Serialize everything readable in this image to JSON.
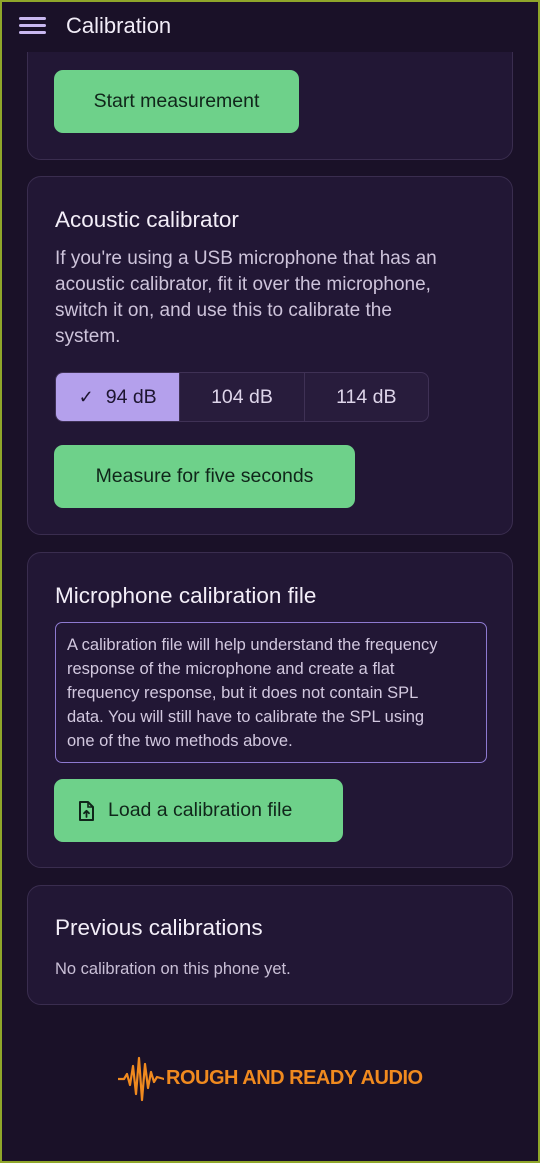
{
  "appbar": {
    "title": "Calibration"
  },
  "start_card": {
    "button_label": "Start measurement"
  },
  "acoustic": {
    "title": "Acoustic calibrator",
    "description_lines": [
      "If you're using a USB microphone that has an",
      "acoustic calibrator, fit it over the microphone,",
      "switch it on, and use this to calibrate the",
      "system."
    ],
    "options": [
      "94 dB",
      "104 dB",
      "114 dB"
    ],
    "selected_option": "94 dB",
    "measure_label": "Measure for five seconds"
  },
  "mic_file": {
    "title": "Microphone calibration file",
    "info_lines": [
      "A calibration file will help understand the frequency",
      "response of the microphone and create a flat",
      "frequency response, but it does not contain SPL",
      "data. You will still have to calibrate the SPL using",
      "one of the two methods above."
    ],
    "load_label": "Load a calibration file",
    "load_icon": "file-upload-icon"
  },
  "previous": {
    "title": "Previous calibrations",
    "empty_text": "No calibration on this phone yet."
  },
  "logo": {
    "text": "ROUGH AND READY AUDIO"
  },
  "colors": {
    "background": "#1a1128",
    "card": "#221735",
    "accent_green": "#6ed18a",
    "selected_segment": "#b4a0ec",
    "logo_orange": "#f08a1f"
  }
}
